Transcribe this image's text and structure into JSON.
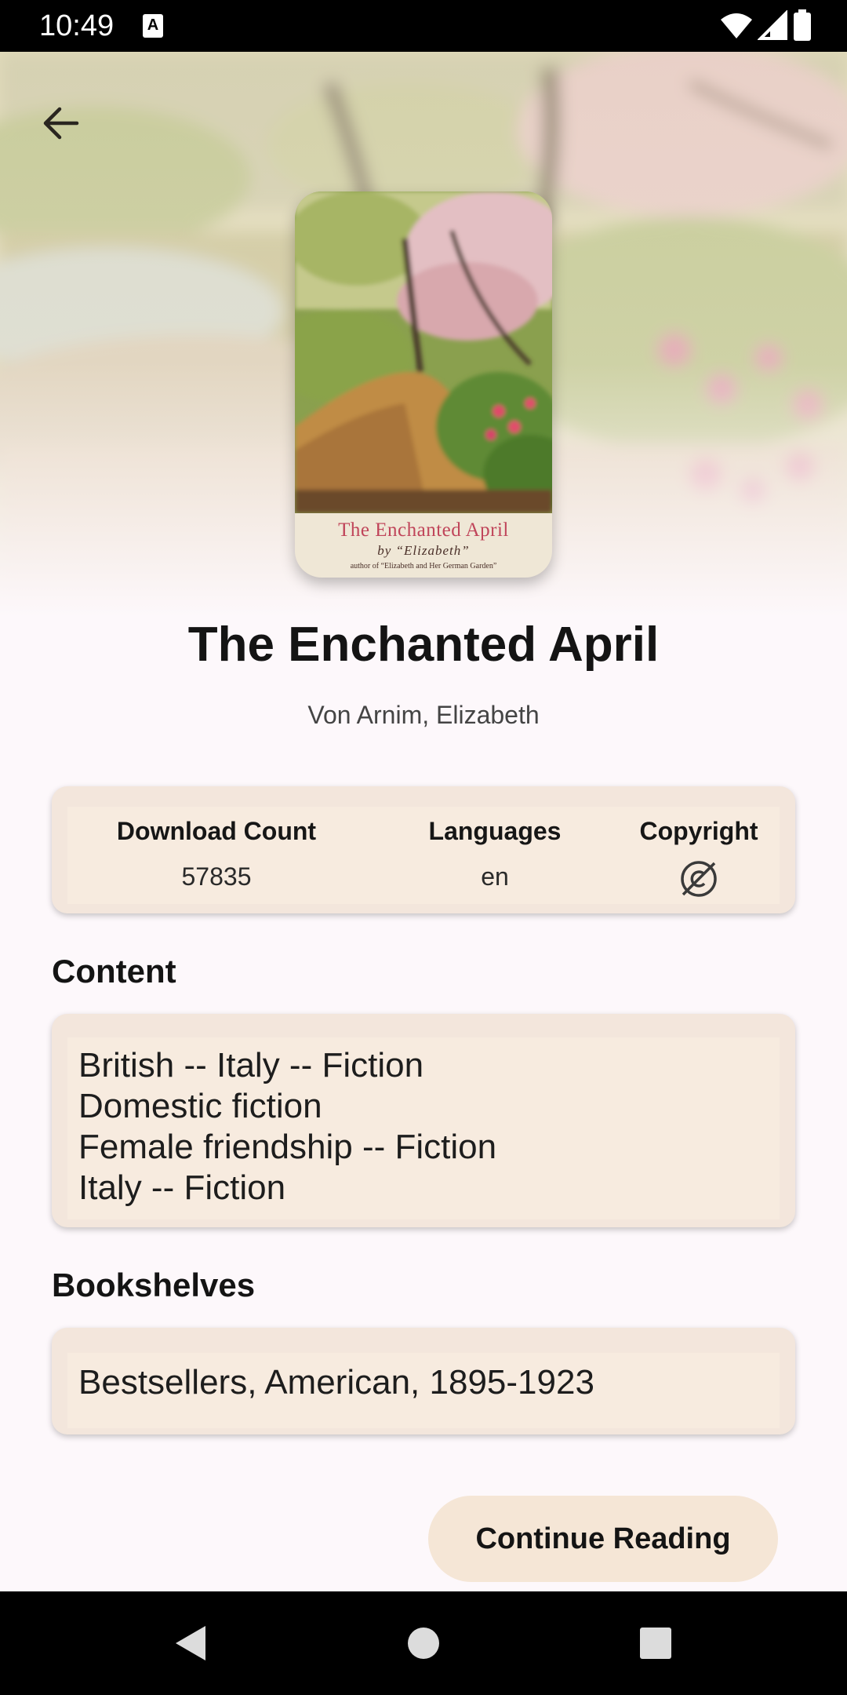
{
  "status_bar": {
    "time": "10:49",
    "notification_icon": "a-letter-icon",
    "icons": [
      "wifi-icon",
      "signal-icon",
      "battery-icon"
    ]
  },
  "header": {
    "back_icon": "arrow-left-icon"
  },
  "cover": {
    "title": "The Enchanted April",
    "byline": "by “Elizabeth”",
    "note": "author of “Elizabeth and Her German Garden”"
  },
  "book": {
    "title": "The Enchanted April",
    "author": "Von Arnim, Elizabeth"
  },
  "stats": {
    "download_label": "Download Count",
    "download_value": "57835",
    "languages_label": "Languages",
    "languages_value": "en",
    "copyright_label": "Copyright",
    "copyright_icon": "copyright-off-icon"
  },
  "content": {
    "heading": "Content",
    "items": [
      "British -- Italy -- Fiction",
      "Domestic fiction",
      "Female friendship -- Fiction",
      "Italy -- Fiction"
    ]
  },
  "bookshelves": {
    "heading": "Bookshelves",
    "text": "Bestsellers, American, 1895-1923"
  },
  "actions": {
    "continue_label": "Continue Reading"
  },
  "colors": {
    "card_bg": "#f3e6dc",
    "button_bg": "#f5e6d6",
    "page_bg": "#fdf8fb",
    "cover_title": "#c0455a"
  }
}
